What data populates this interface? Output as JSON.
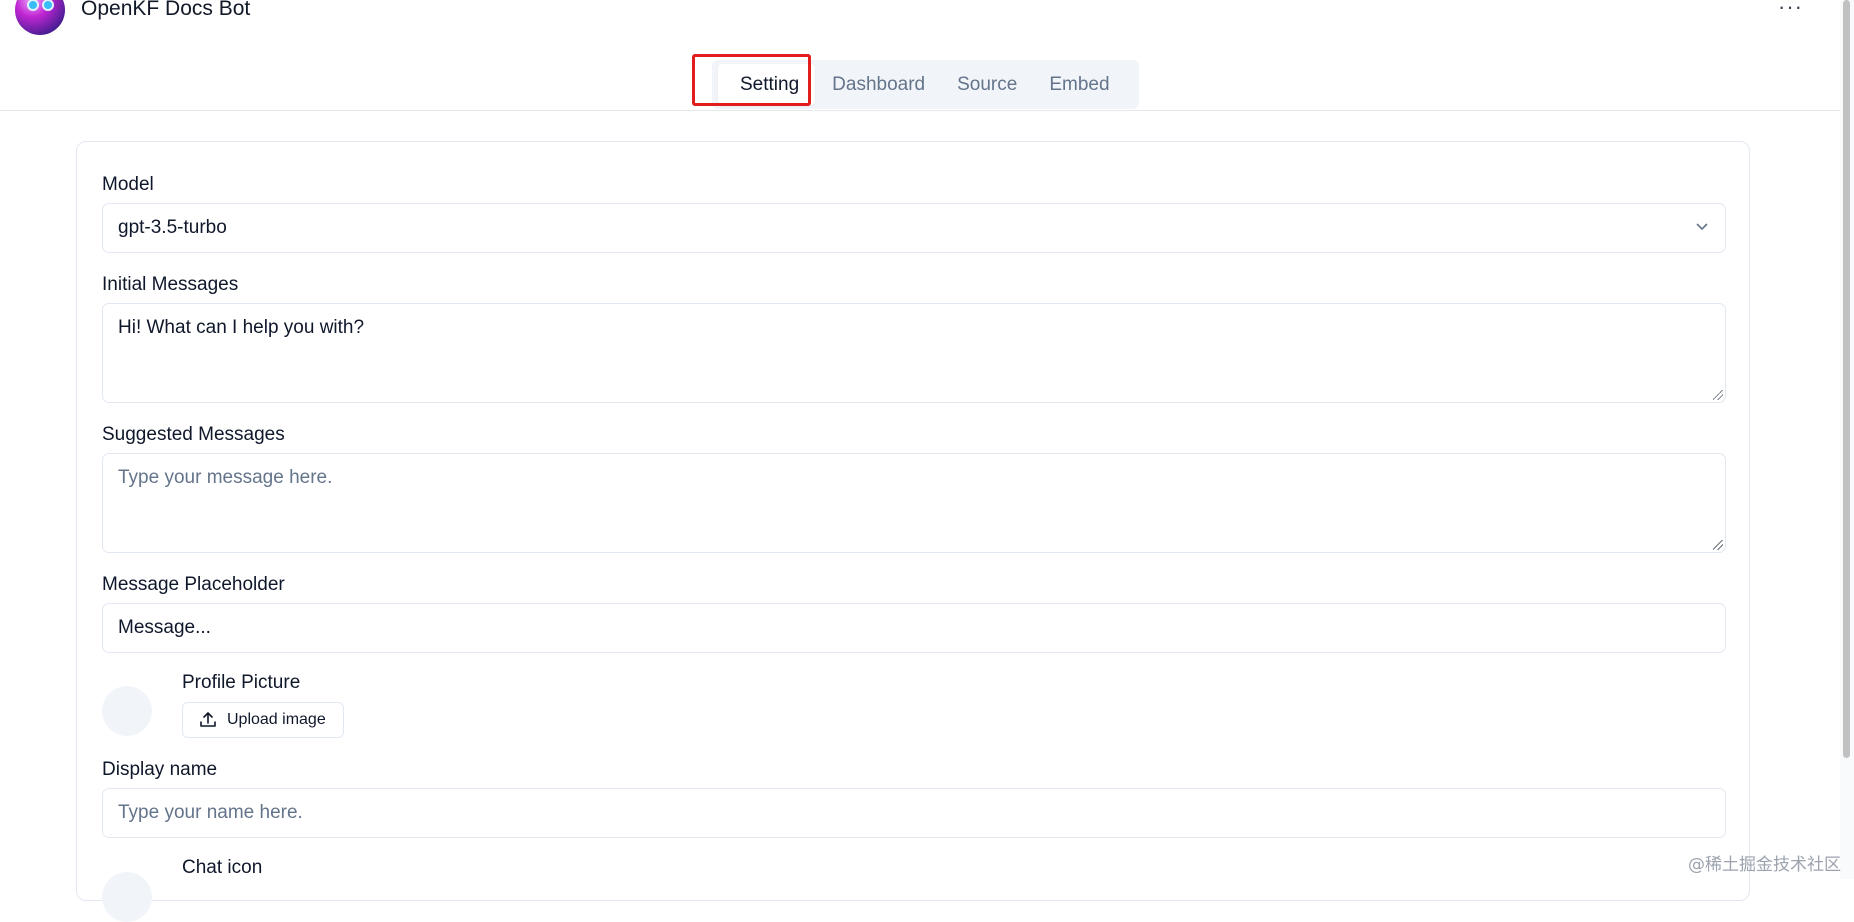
{
  "header": {
    "title": "OpenKF Docs Bot",
    "more_label": "···"
  },
  "tabs": [
    {
      "label": "Setting",
      "active": true
    },
    {
      "label": "Dashboard",
      "active": false
    },
    {
      "label": "Source",
      "active": false
    },
    {
      "label": "Embed",
      "active": false
    }
  ],
  "form": {
    "model": {
      "label": "Model",
      "value": "gpt-3.5-turbo"
    },
    "initial_messages": {
      "label": "Initial Messages",
      "value": "Hi! What can I help you with?"
    },
    "suggested_messages": {
      "label": "Suggested Messages",
      "placeholder": "Type your message here."
    },
    "message_placeholder": {
      "label": "Message Placeholder",
      "value": "Message..."
    },
    "profile_picture": {
      "label": "Profile Picture",
      "upload_label": "Upload image"
    },
    "display_name": {
      "label": "Display name",
      "placeholder": "Type your name here."
    },
    "chat_icon": {
      "label": "Chat icon"
    }
  },
  "watermark": "@稀土掘金技术社区",
  "colors": {
    "highlight": "#e11d1d",
    "tabs_bg": "#f1f5f9",
    "border": "#e2e8f0"
  }
}
